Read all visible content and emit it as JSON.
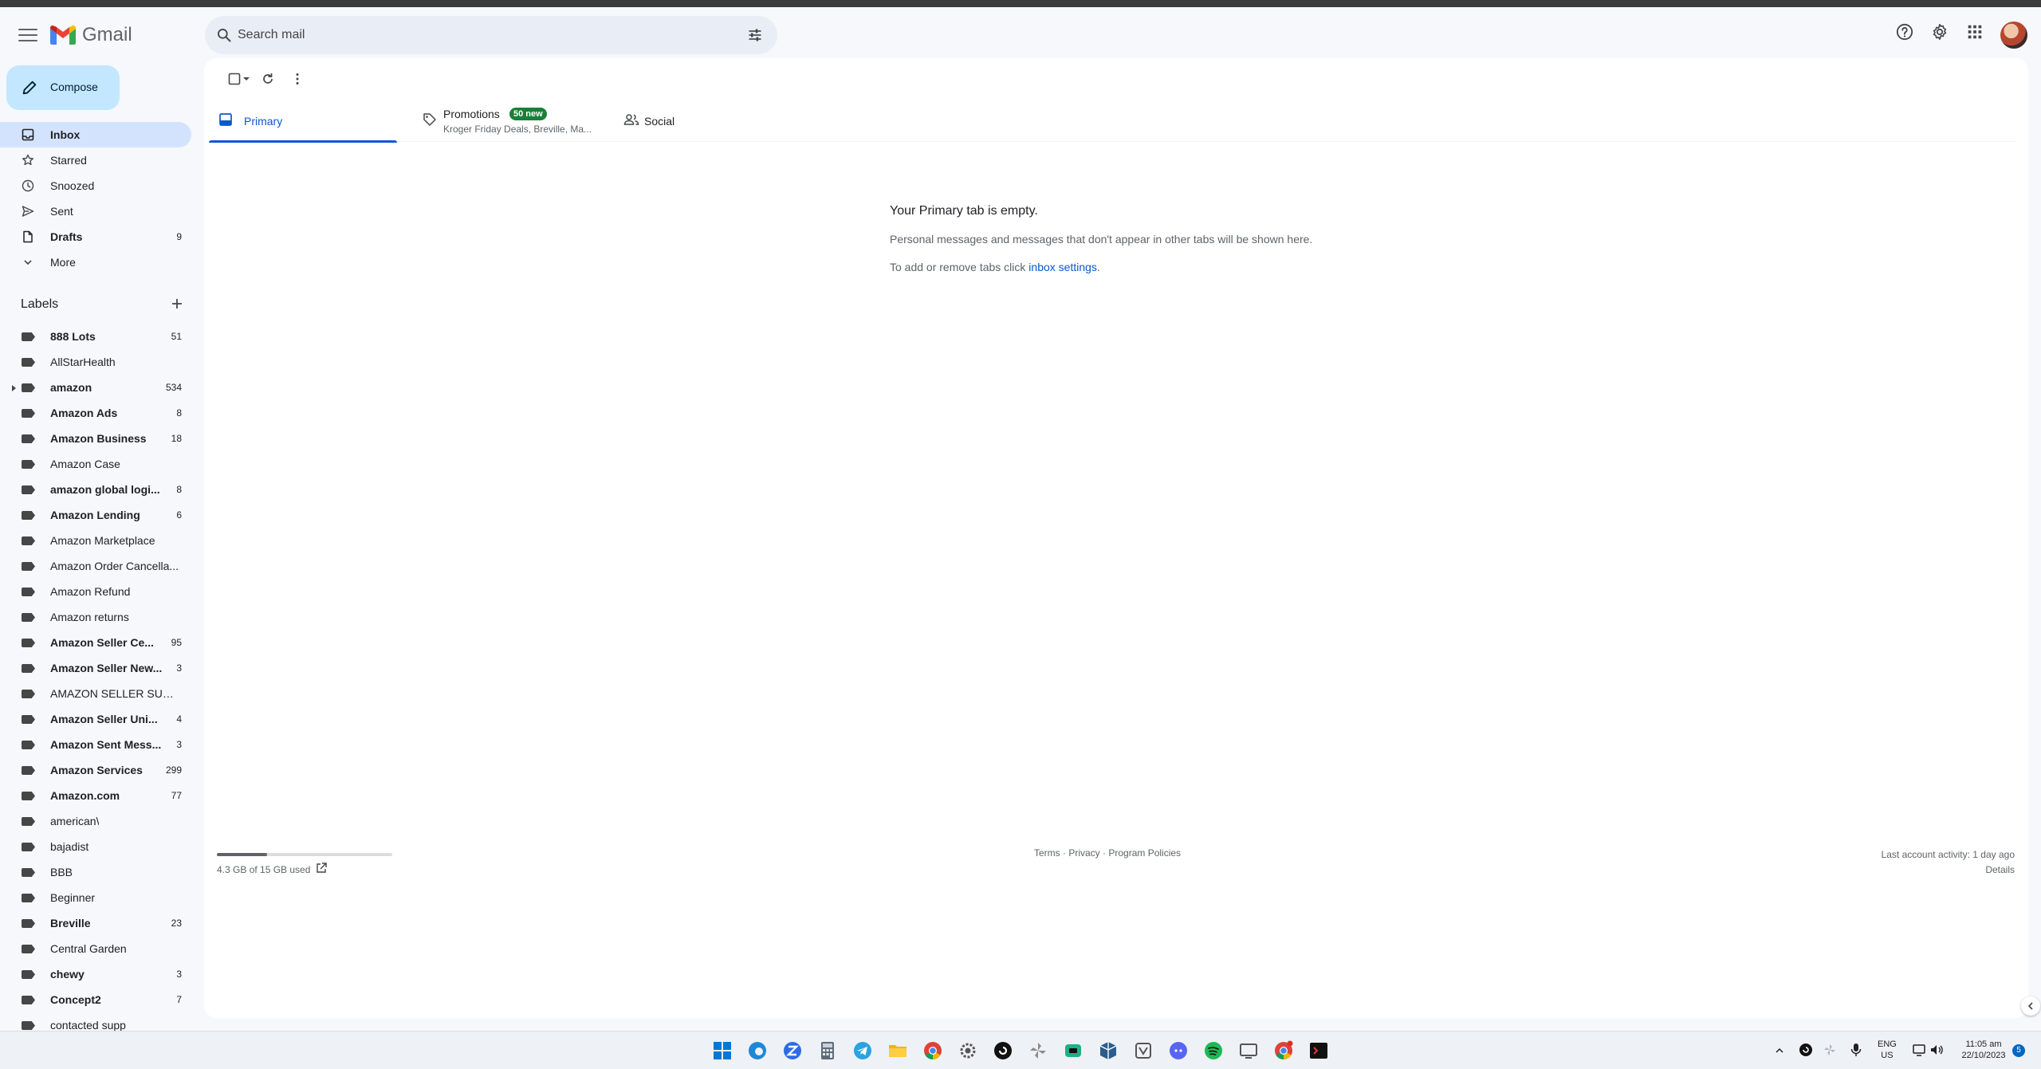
{
  "app": {
    "title": "Gmail"
  },
  "search": {
    "placeholder": "Search mail"
  },
  "compose": {
    "label": "Compose"
  },
  "nav": [
    {
      "label": "Inbox",
      "count": "",
      "active": true,
      "bold": true
    },
    {
      "label": "Starred",
      "count": "",
      "active": false,
      "bold": false
    },
    {
      "label": "Snoozed",
      "count": "",
      "active": false,
      "bold": false
    },
    {
      "label": "Sent",
      "count": "",
      "active": false,
      "bold": false
    },
    {
      "label": "Drafts",
      "count": "9",
      "active": false,
      "bold": true
    },
    {
      "label": "More",
      "count": "",
      "active": false,
      "bold": false
    }
  ],
  "labels_heading": "Labels",
  "labels": [
    {
      "name": "888 Lots",
      "count": "51",
      "bold": true
    },
    {
      "name": "AllStarHealth",
      "count": "",
      "bold": false
    },
    {
      "name": "amazon",
      "count": "534",
      "bold": true,
      "expandable": true
    },
    {
      "name": "Amazon Ads",
      "count": "8",
      "bold": true
    },
    {
      "name": "Amazon Business",
      "count": "18",
      "bold": true
    },
    {
      "name": "Amazon Case",
      "count": "",
      "bold": false
    },
    {
      "name": "amazon global logi...",
      "count": "8",
      "bold": true
    },
    {
      "name": "Amazon Lending",
      "count": "6",
      "bold": true
    },
    {
      "name": "Amazon Marketplace",
      "count": "",
      "bold": false
    },
    {
      "name": "Amazon Order Cancella...",
      "count": "",
      "bold": false
    },
    {
      "name": "Amazon Refund",
      "count": "",
      "bold": false
    },
    {
      "name": "Amazon returns",
      "count": "",
      "bold": false
    },
    {
      "name": "Amazon Seller Ce...",
      "count": "95",
      "bold": true
    },
    {
      "name": "Amazon Seller New...",
      "count": "3",
      "bold": true
    },
    {
      "name": "AMAZON SELLER SUPP...",
      "count": "",
      "bold": false
    },
    {
      "name": "Amazon Seller Uni...",
      "count": "4",
      "bold": true
    },
    {
      "name": "Amazon Sent Mess...",
      "count": "3",
      "bold": true
    },
    {
      "name": "Amazon Services",
      "count": "299",
      "bold": true
    },
    {
      "name": "Amazon.com",
      "count": "77",
      "bold": true
    },
    {
      "name": "american\\",
      "count": "",
      "bold": false
    },
    {
      "name": "bajadist",
      "count": "",
      "bold": false
    },
    {
      "name": "BBB",
      "count": "",
      "bold": false
    },
    {
      "name": "Beginner",
      "count": "",
      "bold": false
    },
    {
      "name": "Breville",
      "count": "23",
      "bold": true
    },
    {
      "name": "Central Garden",
      "count": "",
      "bold": false
    },
    {
      "name": "chewy",
      "count": "3",
      "bold": true
    },
    {
      "name": "Concept2",
      "count": "7",
      "bold": true
    },
    {
      "name": "contacted supp",
      "count": "",
      "bold": false
    }
  ],
  "tabs": {
    "primary": "Primary",
    "promotions": "Promotions",
    "promotions_badge": "50 new",
    "promotions_snippet": "Kroger Friday Deals, Breville, Ma...",
    "social": "Social"
  },
  "empty": {
    "title": "Your Primary tab is empty.",
    "line1": "Personal messages and messages that don't appear in other tabs will be shown here.",
    "line2_prefix": "To add or remove tabs click ",
    "line2_link": "inbox settings",
    "line2_suffix": "."
  },
  "storage": {
    "text": "4.3 GB of 15 GB used",
    "fraction": 0.287
  },
  "footer": {
    "terms": "Terms",
    "sep1": " · ",
    "privacy": "Privacy",
    "sep2": " · ",
    "policies": "Program Policies"
  },
  "activity": {
    "text": "Last account activity: 1 day ago",
    "details": "Details"
  },
  "tray": {
    "lang": "ENG",
    "region": "US",
    "time": "11:05 am",
    "date": "22/10/2023",
    "notif_count": "5"
  },
  "colors": {
    "accent": "#0b57d0",
    "compose_bg": "#c2e7ff",
    "active_nav": "#d3e3fd",
    "badge": "#188038"
  }
}
